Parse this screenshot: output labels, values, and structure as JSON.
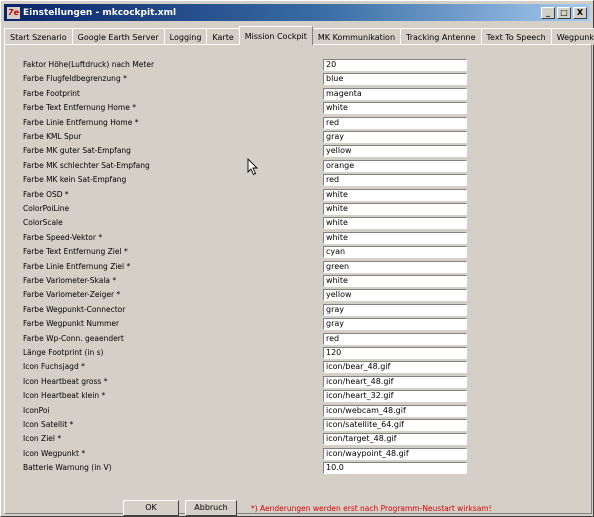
{
  "window": {
    "title": "Einstellungen - mkcockpit.xml",
    "app_icon": "7e",
    "controls": [
      "_",
      "□",
      "X"
    ]
  },
  "tabs": [
    {
      "label": "Start Szenario"
    },
    {
      "label": "Google Earth Server"
    },
    {
      "label": "Logging"
    },
    {
      "label": "Karte"
    },
    {
      "label": "Mission Cockpit"
    },
    {
      "label": "MK Kommunikation"
    },
    {
      "label": "Tracking Antenne"
    },
    {
      "label": "Text To Speech"
    },
    {
      "label": "Wegpunkte"
    }
  ],
  "active_tab": "Mission Cockpit",
  "settings": [
    {
      "label": "Faktor Höhe(Luftdruck) nach Meter",
      "value": "20"
    },
    {
      "label": "Farbe Flugfeldbegrenzung *",
      "value": "blue"
    },
    {
      "label": "Farbe Footprint",
      "value": "magenta"
    },
    {
      "label": "Farbe Text Entfernung Home *",
      "value": "white"
    },
    {
      "label": "Farbe Linie Entfernung Home *",
      "value": "red"
    },
    {
      "label": "Farbe KML Spur",
      "value": "gray"
    },
    {
      "label": "Farbe MK guter Sat-Empfang",
      "value": "yellow"
    },
    {
      "label": "Farbe MK schlechter Sat-Empfang",
      "value": "orange"
    },
    {
      "label": "Farbe MK kein Sat-Empfang",
      "value": "red"
    },
    {
      "label": "Farbe OSD *",
      "value": "white"
    },
    {
      "label": "ColorPoiLine",
      "value": "white"
    },
    {
      "label": "ColorScale",
      "value": "white"
    },
    {
      "label": "Farbe Speed-Vektor *",
      "value": "white"
    },
    {
      "label": "Farbe Text Entfernung Ziel *",
      "value": "cyan"
    },
    {
      "label": "Farbe Linie Entfernung Ziel *",
      "value": "green"
    },
    {
      "label": "Farbe Variometer-Skala *",
      "value": "white"
    },
    {
      "label": "Farbe Variometer-Zeiger *",
      "value": "yellow"
    },
    {
      "label": "Farbe Wegpunkt-Connector",
      "value": "gray"
    },
    {
      "label": "Farbe Wegpunkt Nummer",
      "value": "gray"
    },
    {
      "label": "Farbe Wp-Conn. geaendert",
      "value": "red"
    },
    {
      "label": "Länge Footprint (in s)",
      "value": "120"
    },
    {
      "label": "Icon Fuchsjagd *",
      "value": "icon/bear_48.gif"
    },
    {
      "label": "Icon Heartbeat gross *",
      "value": "icon/heart_48.gif"
    },
    {
      "label": "Icon Heartbeat klein *",
      "value": "icon/heart_32.gif"
    },
    {
      "label": "IconPoi",
      "value": "icon/webcam_48.gif"
    },
    {
      "label": "Icon Satellit *",
      "value": "icon/satellite_64.gif"
    },
    {
      "label": "Icon Ziel *",
      "value": "icon/target_48.gif"
    },
    {
      "label": "Icon Wegpunkt *",
      "value": "icon/waypoint_48.gif"
    },
    {
      "label": "Batterie Warnung (in V)",
      "value": "10.0"
    }
  ],
  "buttons": {
    "ok": "OK",
    "cancel": "Abbruch"
  },
  "note": "*) Aenderungen werden erst nach Programm-Neustart wirksam!",
  "colors": {
    "title_start": "#0a246a",
    "title_end": "#a6caf0",
    "note": "#e00000",
    "dialog_bg": "#d4d0c8"
  },
  "icons": {
    "cursor": "mouse-pointer-icon",
    "app": "app-icon"
  }
}
